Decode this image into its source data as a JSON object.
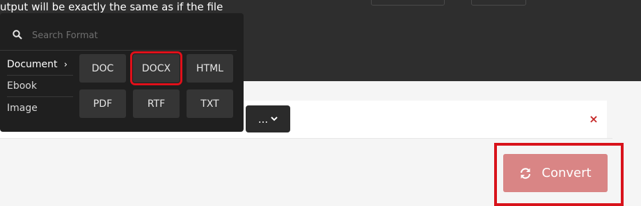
{
  "intro_text": "utput will be exactly the same as if the file",
  "search": {
    "placeholder": "Search Format",
    "value": ""
  },
  "categories": [
    {
      "label": "Document",
      "arrow": "›"
    },
    {
      "label": "Ebook",
      "arrow": ""
    },
    {
      "label": "Image",
      "arrow": ""
    }
  ],
  "formats": [
    "DOC",
    "DOCX",
    "HTML",
    "PDF",
    "RTF",
    "TXT"
  ],
  "selected_format": "DOCX",
  "options_button": {
    "label": "...",
    "chevron": "⌄"
  },
  "remove_icon": "×",
  "convert_button": {
    "label": "Convert",
    "icon": "sync-icon"
  },
  "colors": {
    "accent": "#d98585",
    "highlight": "#d8131b",
    "dark_band": "#2e2e2e",
    "dropdown_bg": "#1f1f1f"
  }
}
